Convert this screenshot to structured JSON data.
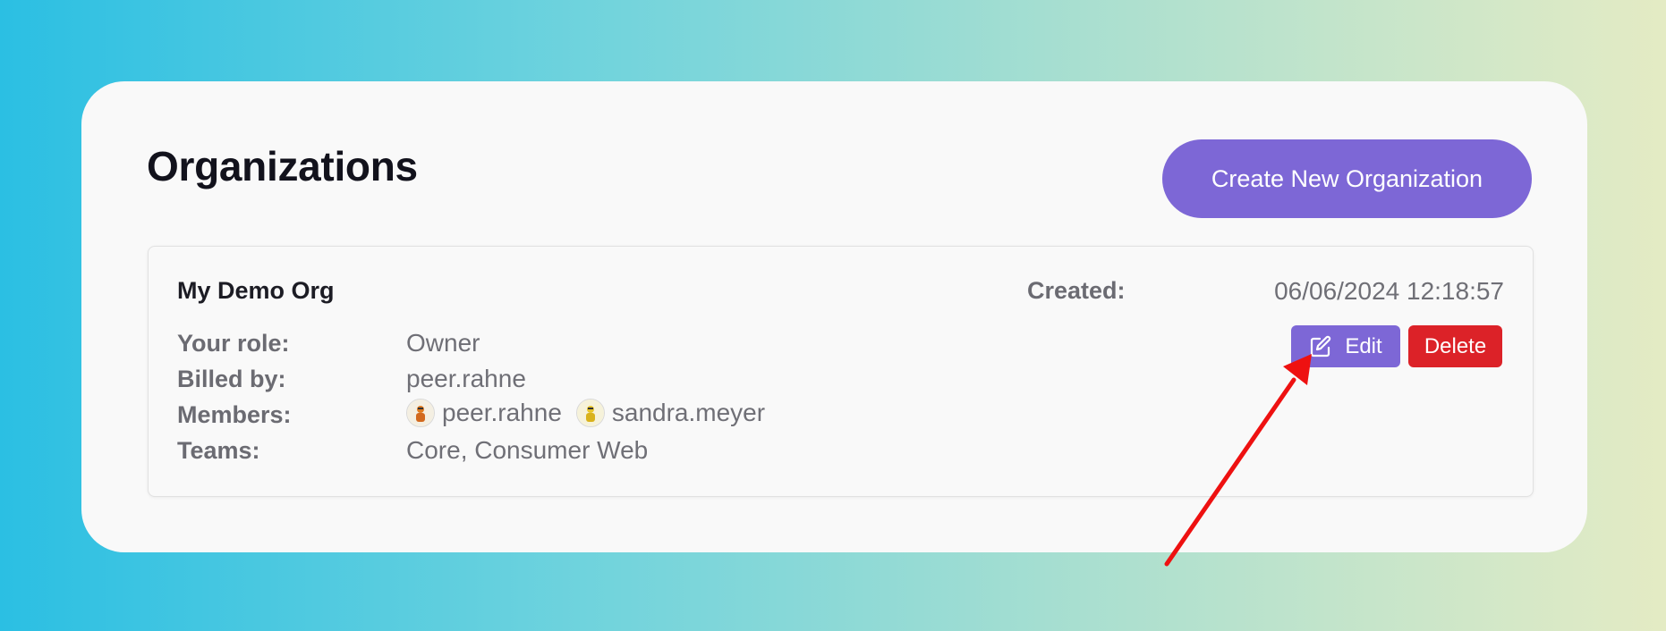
{
  "page": {
    "title": "Organizations",
    "create_button_label": "Create New Organization"
  },
  "org": {
    "name": "My Demo Org",
    "created_label": "Created:",
    "created_value": "06/06/2024 12:18:57",
    "role_label": "Your role:",
    "role_value": "Owner",
    "billed_label": "Billed by:",
    "billed_value": "peer.rahne",
    "members_label": "Members:",
    "members": [
      {
        "name": "peer.rahne",
        "avatar": "avatar-icon"
      },
      {
        "name": "sandra.meyer",
        "avatar": "avatar-icon"
      }
    ],
    "teams_label": "Teams:",
    "teams_value": "Core, Consumer Web",
    "edit_label": "Edit",
    "delete_label": "Delete"
  },
  "icons": {
    "edit": "edit-icon",
    "annotation": "arrow-annotation"
  },
  "colors": {
    "accent": "#7d67d6",
    "danger": "#dc2228",
    "annotation_arrow": "#ee1111"
  }
}
